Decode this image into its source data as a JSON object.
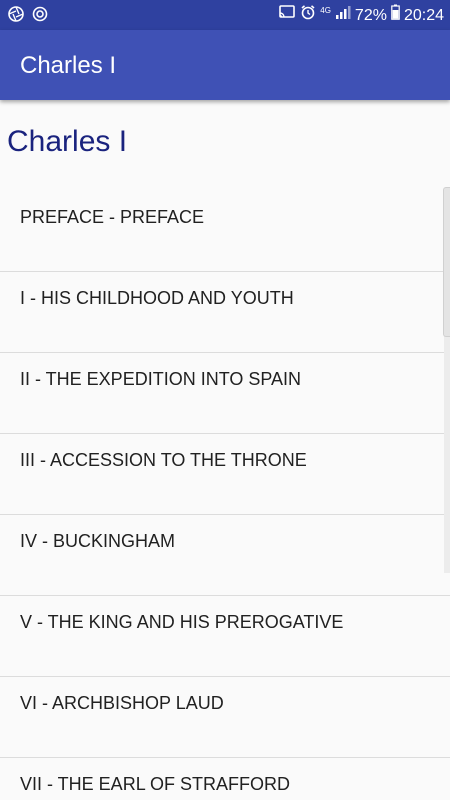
{
  "status_bar": {
    "left_icons": [
      "aperture-icon",
      "sync-icon"
    ],
    "right_icons": [
      "cast-icon",
      "alarm-icon",
      "signal-icon"
    ],
    "network": "4G",
    "battery": "72%",
    "time": "20:24"
  },
  "app_bar": {
    "title": "Charles I"
  },
  "page": {
    "heading": "Charles I"
  },
  "chapters": [
    {
      "label": "PREFACE - PREFACE"
    },
    {
      "label": "I - HIS CHILDHOOD AND YOUTH"
    },
    {
      "label": "II - THE EXPEDITION INTO SPAIN"
    },
    {
      "label": "III - ACCESSION TO THE THRONE"
    },
    {
      "label": "IV - BUCKINGHAM"
    },
    {
      "label": "V - THE KING AND HIS PREROGATIVE"
    },
    {
      "label": "VI - ARCHBISHOP LAUD"
    },
    {
      "label": "VII - THE EARL OF STRAFFORD"
    }
  ],
  "colors": {
    "status_bar": "#2f41a0",
    "app_bar": "#3f51b5",
    "heading": "#1a237e",
    "background": "#fafafa"
  }
}
